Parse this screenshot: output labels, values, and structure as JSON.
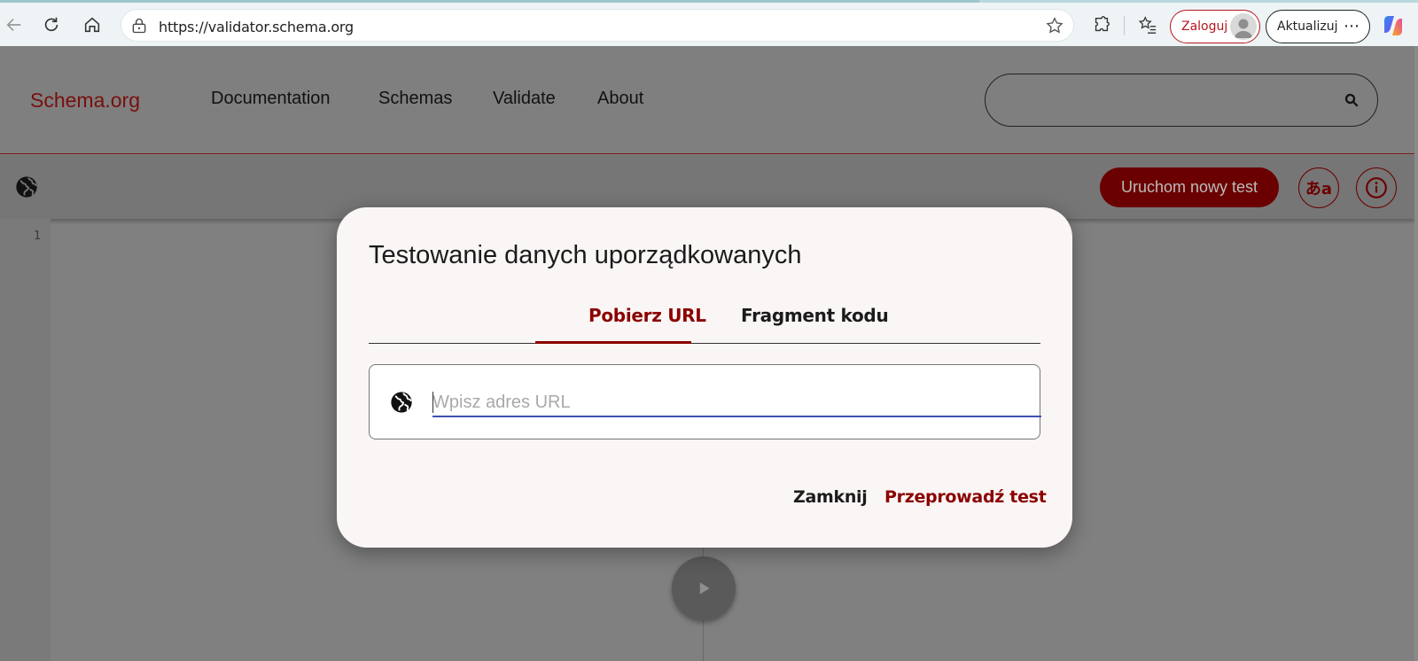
{
  "browser": {
    "url": "https://validator.schema.org",
    "login_label": "Zaloguj",
    "update_label": "Aktualizuj"
  },
  "site": {
    "brand": "Schema.org",
    "menu": [
      "Documentation",
      "Schemas",
      "Validate",
      "About"
    ]
  },
  "toolbar": {
    "run_new_test": "Uruchom nowy test"
  },
  "editor": {
    "line_number": "1"
  },
  "dialog": {
    "title": "Testowanie danych uporządkowanych",
    "tabs": [
      {
        "label": "Pobierz URL",
        "active": true
      },
      {
        "label": "Fragment kodu",
        "active": false
      }
    ],
    "url_placeholder": "Wpisz adres URL",
    "close_label": "Zamknij",
    "run_label": "Przeprowadź test"
  },
  "colors": {
    "accent": "#8b0000",
    "input_underline": "#3f51b5"
  }
}
